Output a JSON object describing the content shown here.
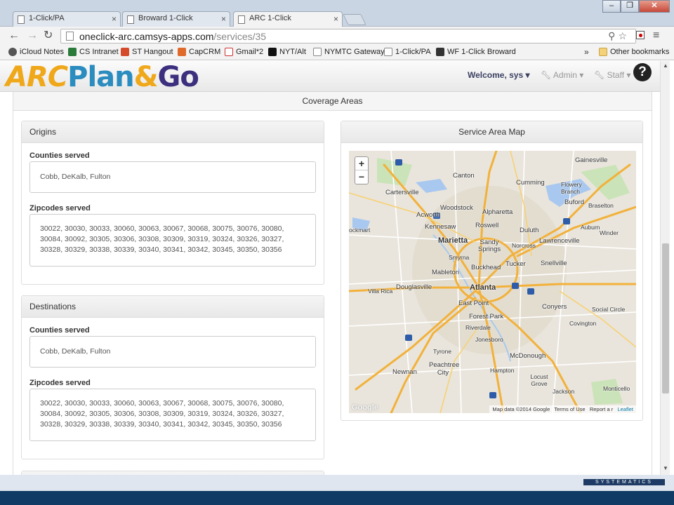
{
  "browser": {
    "tabs": [
      {
        "title": "1-Click/PA"
      },
      {
        "title": "Broward 1-Click"
      },
      {
        "title": "ARC 1-Click"
      }
    ],
    "url_host": "oneclick-arc.camsys-apps.com",
    "url_path": "/services/35",
    "bookmarks": [
      {
        "label": "iCloud Notes"
      },
      {
        "label": "CS Intranet"
      },
      {
        "label": "ST Hangout"
      },
      {
        "label": "CapCRM"
      },
      {
        "label": "Gmail*2"
      },
      {
        "label": "NYT/Alt"
      },
      {
        "label": "NYMTC Gateway"
      },
      {
        "label": "1-Click/PA"
      },
      {
        "label": "WF 1-Click Broward"
      }
    ],
    "more_bookmarks": "»",
    "other_bookmarks": "Other bookmarks"
  },
  "app": {
    "logo": {
      "arc": "ARC",
      "plan": "Plan",
      "amp": "&",
      "go": "Go"
    },
    "welcome": "Welcome, sys",
    "admin": "Admin",
    "staff": "Staff",
    "help": "?"
  },
  "page": {
    "heading": "Coverage Areas",
    "origins": {
      "title": "Origins",
      "counties_label": "Counties served",
      "counties": "Cobb, DeKalb, Fulton",
      "zipcodes_label": "Zipcodes served",
      "zipcodes": "30022, 30030, 30033, 30060, 30063, 30067, 30068, 30075, 30076, 30080, 30084, 30092, 30305, 30306, 30308, 30309, 30319, 30324, 30326, 30327, 30328, 30329, 30338, 30339, 30340, 30341, 30342, 30345, 30350, 30356"
    },
    "destinations": {
      "title": "Destinations",
      "counties_label": "Counties served",
      "counties": "Cobb, DeKalb, Fulton",
      "zipcodes_label": "Zipcodes served",
      "zipcodes": "30022, 30030, 30033, 30060, 30063, 30067, 30068, 30075, 30076, 30080, 30084, 30092, 30305, 30306, 30308, 30309, 30319, 30324, 30326, 30327, 30328, 30329, 30338, 30339, 30340, 30341, 30342, 30345, 30350, 30356"
    },
    "map": {
      "title": "Service Area Map",
      "zoom_in": "+",
      "zoom_out": "−",
      "google": "Google",
      "attribution": "Map data ©2014 Google",
      "terms": "Terms of Use",
      "report": "Report a r",
      "leaflet": "Leaflet",
      "places": [
        "Gainesville",
        "Canton",
        "Cumming",
        "Flowery Branch",
        "Cartersville",
        "Buford",
        "Braselton",
        "Woodstock",
        "Alpharetta",
        "Acworth",
        "Kennesaw",
        "Roswell",
        "Duluth",
        "Auburn",
        "Winder",
        "Marietta",
        "Sandy Springs",
        "Norcross",
        "Lawrenceville",
        "Smyrna",
        "Tucker",
        "Snellville",
        "Mableton",
        "Buckhead",
        "Douglasville",
        "Atlanta",
        "Villa Rica",
        "East Point",
        "Conyers",
        "Social Circle",
        "Forest Park",
        "Riverdale",
        "Covington",
        "Jonesboro",
        "Tyrone",
        "McDonough",
        "Peachtree City",
        "Hampton",
        "Newnan",
        "Locust Grove",
        "Jackson",
        "Monticello",
        "ockmart"
      ]
    },
    "company": "SYSTEMATICS"
  },
  "colors": {
    "logo_orange": "#f0a81b",
    "logo_blue": "#2b8cbf",
    "logo_purple": "#3b2f7e",
    "highway": "#f2b13a",
    "bottom_band": "#0f3b64"
  }
}
